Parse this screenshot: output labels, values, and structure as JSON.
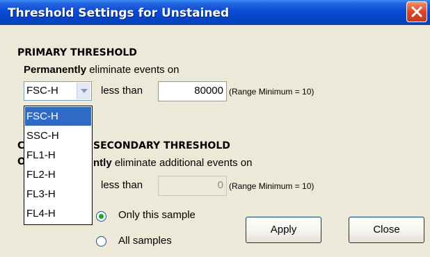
{
  "window": {
    "title": "Threshold Settings for Unstained"
  },
  "primary": {
    "heading": "PRIMARY THRESHOLD",
    "description_bold": "Permanently",
    "description_rest": " eliminate events on",
    "parameter": "FSC-H",
    "comparator": "less than",
    "value": "80000",
    "range_note": "(Range Minimum = 10)"
  },
  "secondary": {
    "heading_visible": "SECONDARY THRESHOLD",
    "prefix_visible_1": "C",
    "prefix_visible_2": "O",
    "description_bold_visible": "ntly",
    "description_rest": " eliminate additional events on",
    "comparator": "less than",
    "value": "0",
    "range_note": "(Range Minimum = 10)"
  },
  "scope": {
    "option_this": "Only this sample",
    "option_all": "All samples",
    "selected": "Only this sample"
  },
  "buttons": {
    "apply": "Apply",
    "close": "Close"
  },
  "dropdown": {
    "options": [
      "FSC-H",
      "SSC-H",
      "FL1-H",
      "FL2-H",
      "FL3-H",
      "FL4-H"
    ],
    "highlighted": "FSC-H"
  },
  "colors": {
    "title_bar": "#0A4AD6",
    "dialog_bg": "#ECE9D8",
    "selection": "#316AC5",
    "close_button": "#D9472A",
    "radio_dot": "#21A121"
  },
  "icons": {
    "close": "close-x-icon",
    "dropdown_arrow": "chevron-down-icon"
  }
}
